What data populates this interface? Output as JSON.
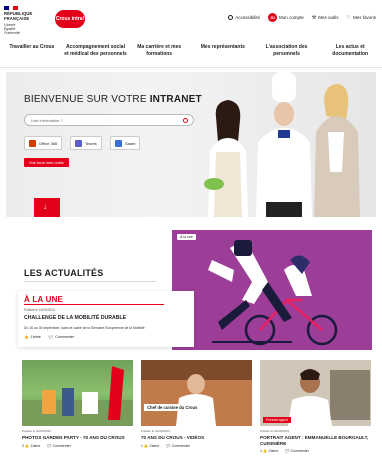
{
  "header": {
    "logo_gov_lines": [
      "RÉPUBLIQUE",
      "FRANÇAISE"
    ],
    "logo_gov_motto": [
      "Liberté",
      "Égalité",
      "Fraternité"
    ],
    "logo_app": "Crous intra!",
    "links": {
      "accessibility": "Accessibilité",
      "account": "Mon compte",
      "tools": "Mes outils",
      "favorites": "Mes favoris"
    },
    "user_initials": "JD"
  },
  "nav": {
    "items": [
      {
        "label": "Travailler au Crous"
      },
      {
        "label": "Accompagnement social et médical des personnels"
      },
      {
        "label": "Ma carrière et mes formations"
      },
      {
        "label": "Mes représentants"
      },
      {
        "label": "L'association des personnels"
      },
      {
        "label": "Les actus et documentation"
      }
    ]
  },
  "hero": {
    "title_pre": "BIENVENUE SUR VOTRE ",
    "title_bold": "INTRANET",
    "search_placeholder": "Une information ?",
    "quick_links": [
      {
        "label": "Office 365",
        "color": "#d83b01"
      },
      {
        "label": "Teams",
        "color": "#5b5fc7"
      },
      {
        "label": "Saam",
        "color": "#3a6fd8"
      }
    ],
    "cta": "Voir tous mes outils"
  },
  "news": {
    "heading": "LES ACTUALITÉS",
    "featured": {
      "big_label": "À LA UNE",
      "date": "Publiée le 16/09/2024",
      "title": "CHALLENGE DE LA MOBILITÉ DURABLE",
      "desc": "Du 16 au 30 septembre, dans le cadre de la Semaine Européenne de la Mobilité",
      "like": "J'aime",
      "comment": "Commenter",
      "badge": "À la une"
    },
    "cards": [
      {
        "date": "Publiée le 02/09/2024",
        "title": "PHOTOS GARDEN PARTY - 70 ANS DU CROUS",
        "likes": "2",
        "like": "J'aime",
        "comment": "Commenter",
        "overlay": ""
      },
      {
        "date": "Publiée le 02/09/2024",
        "title": "70 ANS DU CROUS - VIDÉOS",
        "likes": "1",
        "like": "J'aime",
        "comment": "Commenter",
        "overlay": "Chef de cuisine du Crous"
      },
      {
        "date": "Publiée le 02/09/2024",
        "title": "PORTRAIT AGENT : EMMANUELLE BOURGAULT, CUISINIÈRE",
        "likes": "1",
        "like": "J'aime",
        "comment": "Commenter",
        "overlay": "Portrait agent"
      }
    ]
  },
  "colors": {
    "brand_red": "#e2001a",
    "purple": "#9c3e98"
  }
}
